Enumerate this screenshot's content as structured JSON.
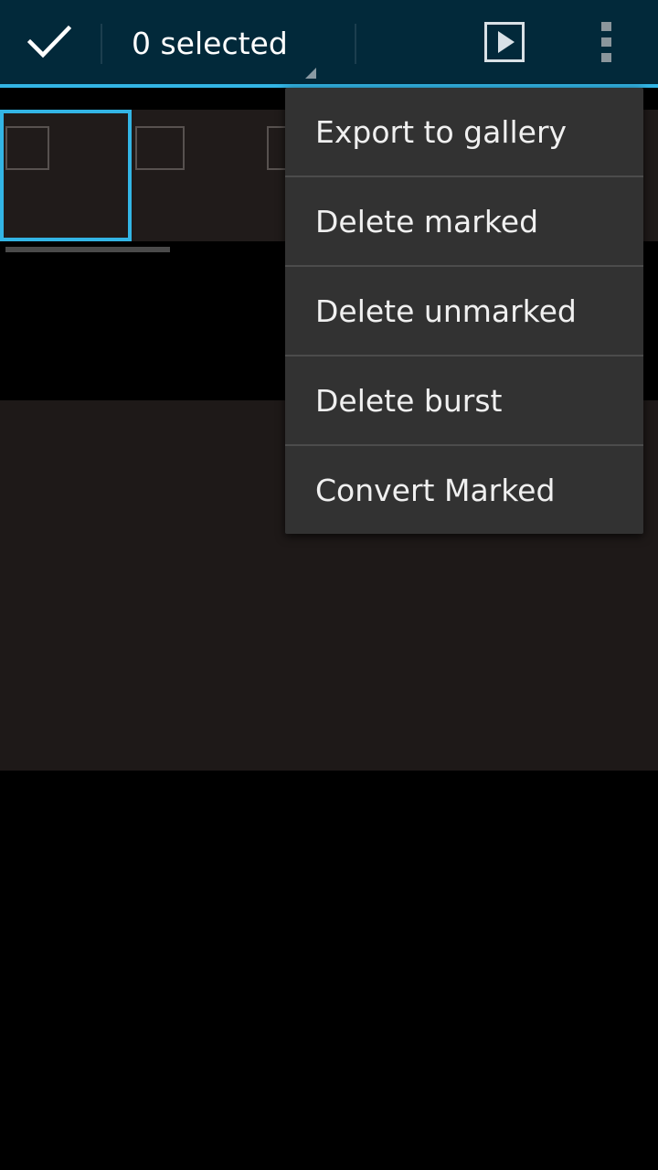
{
  "action_bar": {
    "selection_count": "0 selected",
    "done_icon": "check-icon",
    "play_icon": "play-icon",
    "overflow_icon": "more-vert-icon"
  },
  "thumbnails": {
    "count_visible": 3,
    "selected_index": 0
  },
  "overflow_menu": {
    "items": [
      {
        "label": "Export to gallery"
      },
      {
        "label": "Delete marked"
      },
      {
        "label": "Delete unmarked"
      },
      {
        "label": "Delete burst"
      },
      {
        "label": "Convert Marked"
      }
    ]
  },
  "colors": {
    "action_bar_bg": "#02293a",
    "accent": "#33b5e5",
    "menu_bg": "#323232"
  }
}
